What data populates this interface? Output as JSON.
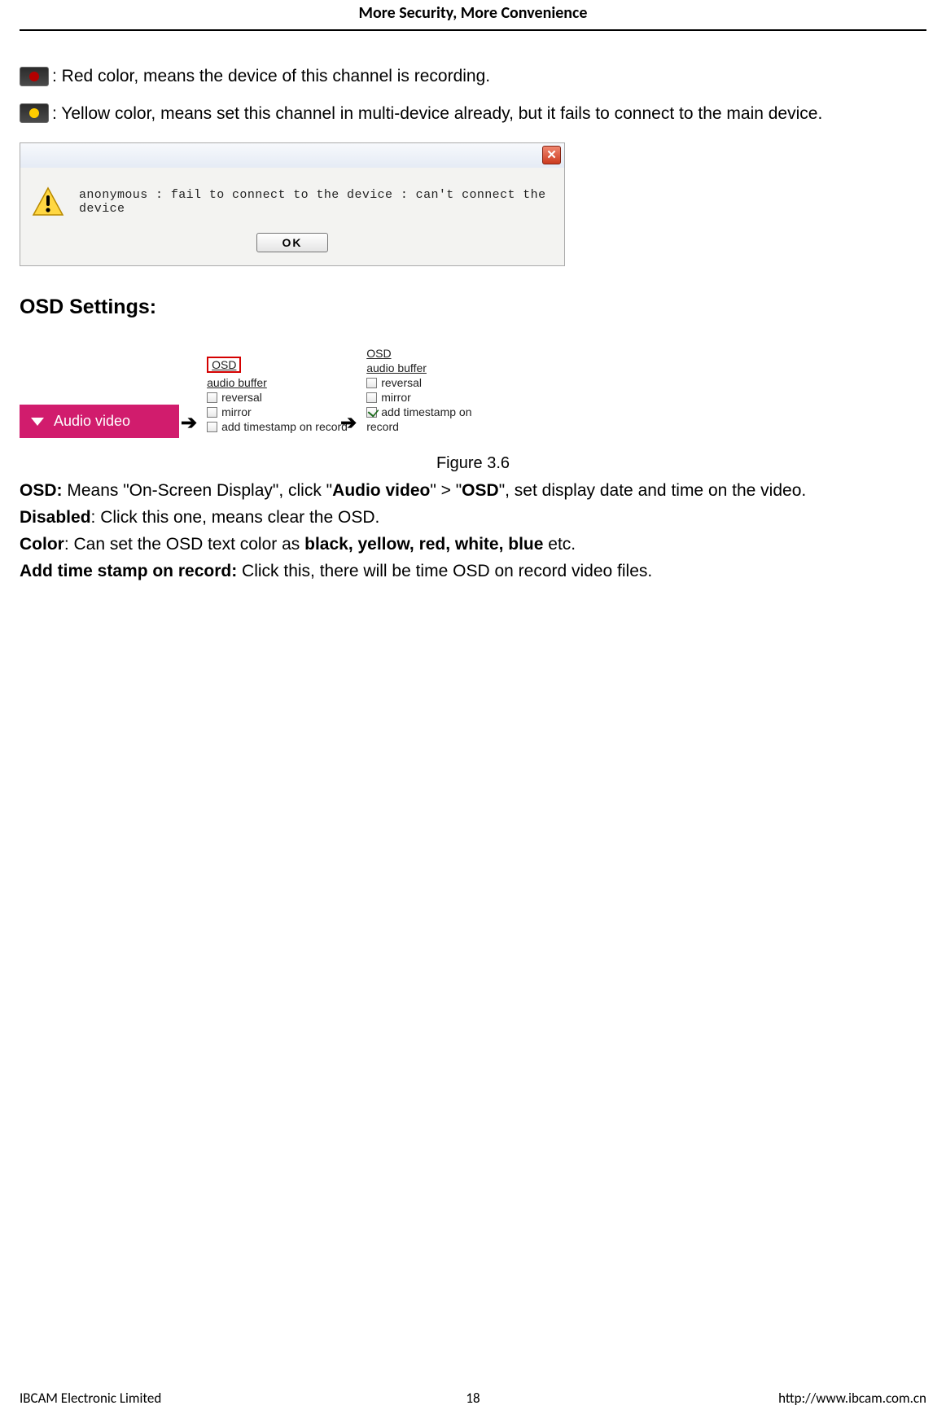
{
  "header": {
    "tagline": "More Security, More Convenience"
  },
  "legend": {
    "red_text": ": Red color, means the device of this channel is recording.",
    "yellow_text": ": Yellow color, means set this channel in multi-device already, but it fails to connect to the main device."
  },
  "dialog": {
    "message": "anonymous : fail to connect to the device : can't connect the device",
    "ok_label": "OK",
    "close_glyph": "✕"
  },
  "osd_heading": "OSD Settings:",
  "audio_tab_label": "Audio video",
  "arrow_glyph": "➔",
  "panel1": {
    "osd": "OSD",
    "audio_buffer": "audio buffer",
    "reversal": "reversal",
    "mirror": "mirror",
    "timestamp": "add timestamp on record"
  },
  "panel2": {
    "osd": "OSD",
    "audio_buffer": "audio buffer",
    "reversal": "reversal",
    "mirror": "mirror",
    "timestamp_l1": "add timestamp on",
    "timestamp_l2": "record"
  },
  "figure_caption": "Figure 3.6",
  "body": {
    "p1_a": "OSD: ",
    "p1_b": "Means \"On-Screen Display\", click \"",
    "p1_c": "Audio video",
    "p1_d": "\" > \"",
    "p1_e": "OSD",
    "p1_f": "\", set display date and time on the video.",
    "p2_a": "Disabled",
    "p2_b": ": Click this one, means clear the OSD.",
    "p3_a": "Color",
    "p3_b": ": Can set the OSD text color as ",
    "p3_c": "black, yellow, red, white, blue",
    "p3_d": " etc.",
    "p4_a": "Add time stamp on record: ",
    "p4_b": "Click this, there will be time OSD on record video files."
  },
  "footer": {
    "left": "IBCAM Electronic Limited",
    "center": "18",
    "right": "http://www.ibcam.com.cn"
  }
}
